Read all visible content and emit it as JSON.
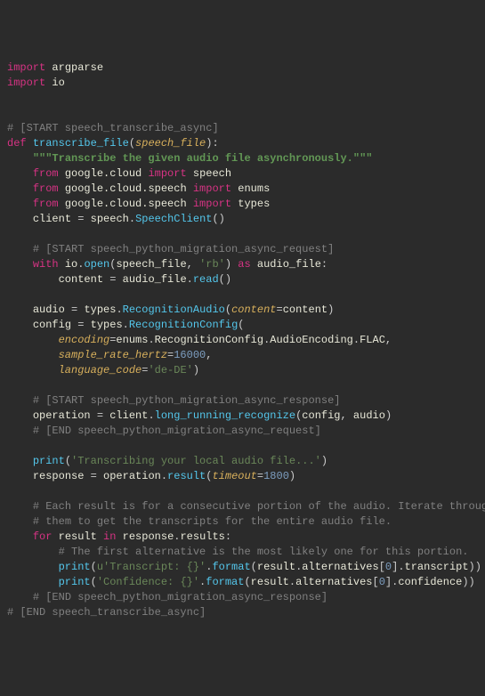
{
  "lines": {
    "l1_import": "import",
    "l1_mod": "argparse",
    "l2_import": "import",
    "l2_mod": "io",
    "blank": "",
    "c1": "# [START speech_transcribe_async]",
    "def": "def",
    "funcname": "transcribe_file",
    "lparen": "(",
    "param": "speech_file",
    "rparen_colon": "):",
    "docstring": "\"\"\"Transcribe the given audio file asynchronously.\"\"\"",
    "from1_from": "from",
    "from1_mod": "google.cloud",
    "from1_import": "import",
    "from1_name": "speech",
    "from2_from": "from",
    "from2_mod": "google.cloud.speech",
    "from2_import": "import",
    "from2_name": "enums",
    "from3_from": "from",
    "from3_mod": "google.cloud.speech",
    "from3_import": "import",
    "from3_name": "types",
    "client_var": "client",
    "eq": " = ",
    "speech_obj": "speech",
    "dot": ".",
    "speechclient": "SpeechClient",
    "parens": "()",
    "c2": "# [START speech_python_migration_async_request]",
    "with": "with",
    "io_obj": "io",
    "open": "open",
    "speech_file_arg": "speech_file",
    "comma_sp": ", ",
    "rb": "'rb'",
    "as": "as",
    "audio_file": "audio_file",
    "colon": ":",
    "content_var": "content",
    "audio_file2": "audio_file",
    "read": "read",
    "audio_var": "audio",
    "types_obj": "types",
    "recaudio": "RecognitionAudio",
    "content_kwarg": "content",
    "content_val": "content",
    "rparen": ")",
    "config_var": "config",
    "recconfig": "RecognitionConfig",
    "encoding_kwarg": "encoding",
    "enums_obj": "enums",
    "recconfig2": "RecognitionConfig",
    "audioenc": "AudioEncoding",
    "flac": "FLAC",
    "comma": ",",
    "srh_kwarg": "sample_rate_hertz",
    "srh_val": "16000",
    "lang_kwarg": "language_code",
    "lang_val": "'de-DE'",
    "c3": "# [START speech_python_migration_async_response]",
    "operation_var": "operation",
    "client_obj": "client",
    "lrr": "long_running_recognize",
    "config_arg": "config",
    "audio_arg": "audio",
    "c4": "# [END speech_python_migration_async_request]",
    "print": "print",
    "transcribing_str": "'Transcribing your local audio file...'",
    "response_var": "response",
    "operation_obj": "operation",
    "result": "result",
    "timeout_kwarg": "timeout",
    "timeout_val": "1800",
    "c5a": "# Each result is for a consecutive portion of the audio. Iterate through",
    "c5b": "# them to get the transcripts for the entire audio file.",
    "for": "for",
    "result_var": "result",
    "in": "in",
    "response_obj": "response",
    "results_attr": "results",
    "c6": "# The first alternative is the most likely one for this portion.",
    "u_prefix": "u",
    "transcript_str": "'Transcript: {}'",
    "format": "format",
    "result_obj": "result",
    "alternatives": "alternatives",
    "lbrack": "[",
    "zero": "0",
    "rbrack": "]",
    "transcript_attr": "transcript",
    "rparen2": "))",
    "confidence_str": "'Confidence: {}'",
    "confidence_attr": "confidence",
    "c7": "# [END speech_python_migration_async_response]",
    "c8": "# [END speech_transcribe_async]"
  }
}
